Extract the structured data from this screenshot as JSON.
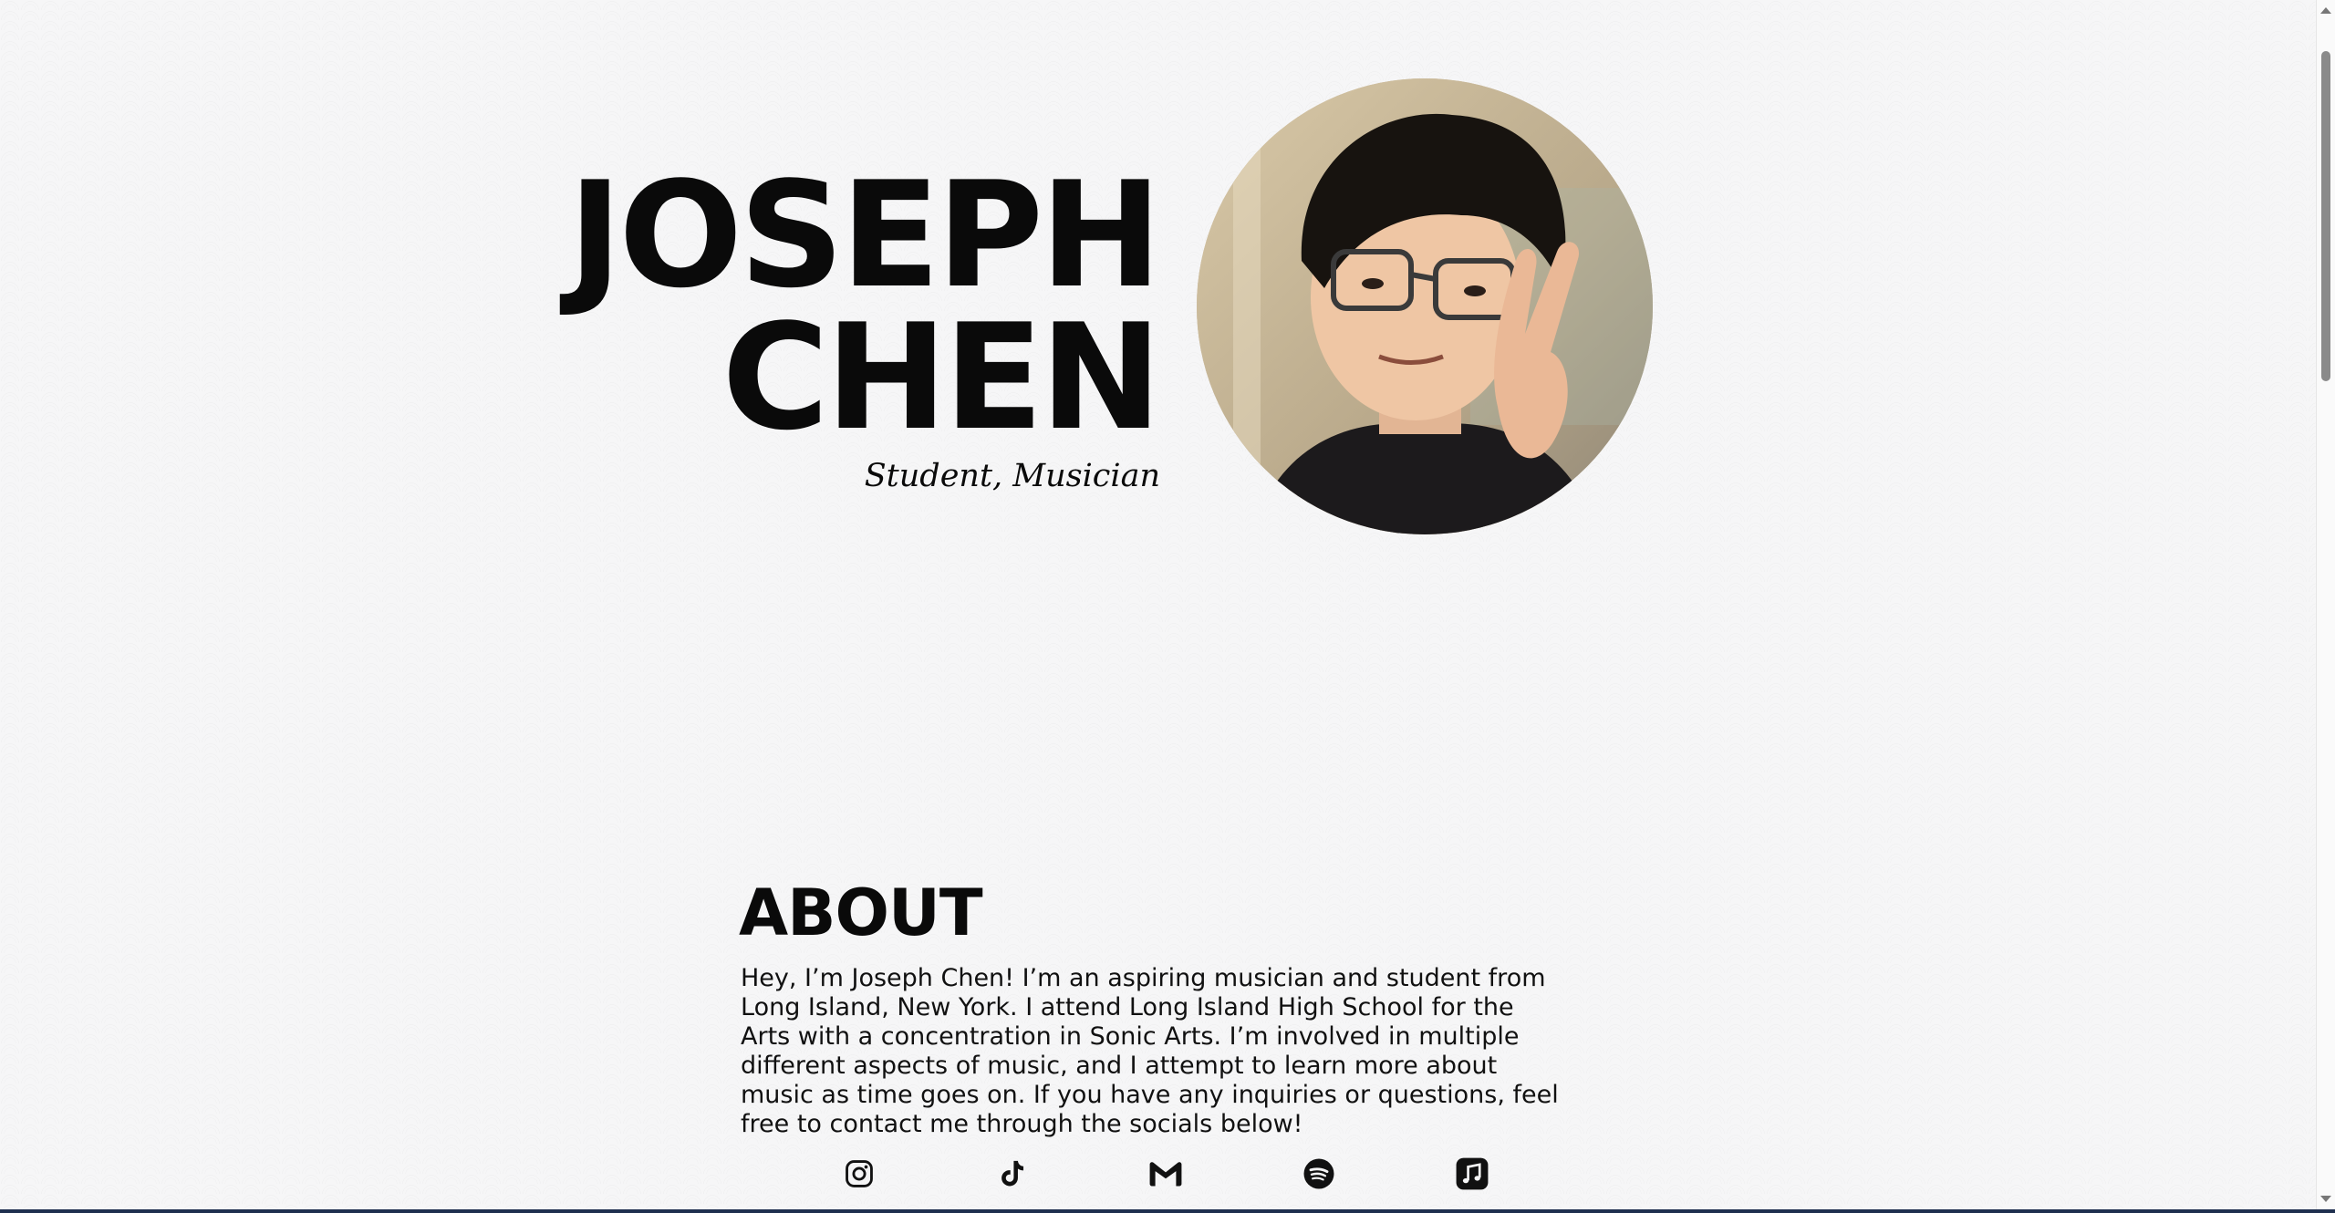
{
  "hero": {
    "name_line1": "JOSEPH",
    "name_line2": "CHEN",
    "subtitle": "Student, Musician"
  },
  "about": {
    "title": "ABOUT",
    "text": "Hey, I’m Joseph Chen! I’m an aspiring musician and student from Long Island, New York. I attend Long Island High School for the Arts with a concentration in Sonic Arts. I’m involved in multiple different aspects of music, and I attempt to learn more about music as time goes on. If you have any inquiries or questions, feel free to contact me through the socials below!"
  },
  "socials": [
    {
      "name": "instagram",
      "icon": "instagram-icon"
    },
    {
      "name": "tiktok",
      "icon": "tiktok-icon"
    },
    {
      "name": "gmail",
      "icon": "gmail-icon"
    },
    {
      "name": "spotify",
      "icon": "spotify-icon"
    },
    {
      "name": "apple-music",
      "icon": "apple-music-icon"
    }
  ],
  "colors": {
    "text": "#0a0a0a",
    "background": "#f6f6f7",
    "bottom_strip": "#1f2f4f"
  }
}
